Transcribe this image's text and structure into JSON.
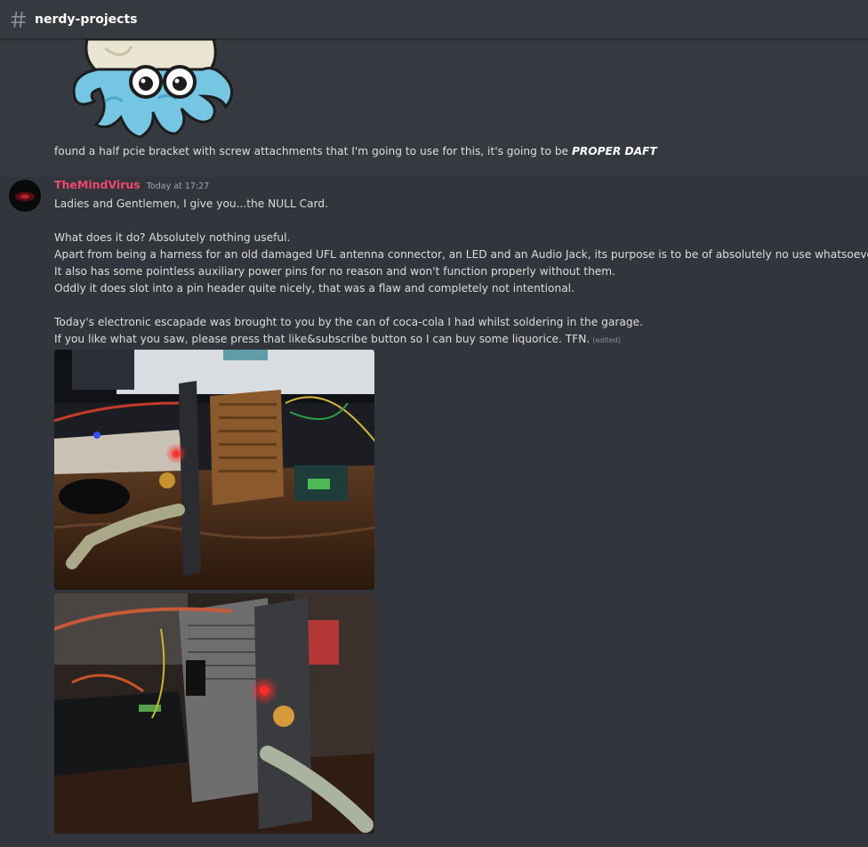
{
  "channel": {
    "name": "nerdy-projects",
    "icon": "hash-icon"
  },
  "messages": {
    "previous": {
      "sticker_icon": "octopus-glasses-sticker",
      "text_prefix": "found a half pcie bracket with screw attachments that I'm going to use for this, it's going to be ",
      "text_emphasis": "PROPER DAFT"
    },
    "current": {
      "author": "TheMindVirus",
      "author_color": "#f04770",
      "timestamp": "Today at 17:27",
      "edited_label": "(edited)",
      "lines": [
        "Ladies and Gentlemen, I give you...the NULL Card.",
        "What does it do? Absolutely nothing useful.",
        "Apart from being a harness for an old damaged UFL antenna connector, an LED and an Audio Jack, its purpose is to be of absolutely no use whatsoever.",
        "It also has some pointless auxiliary power pins for no reason and won't function properly without them.",
        "Oddly it does slot into a pin header quite nicely, that was a flaw and completely not intentional.",
        "Today's electronic escapade was brought to you by the can of coca-cola I had whilst soldering in the garage.",
        "If you like what you saw, please press that like&subscribe button so I can buy some liquorice. TFN."
      ],
      "attachments": [
        {
          "name": "null-card-photo-1"
        },
        {
          "name": "null-card-photo-2"
        }
      ]
    }
  },
  "colors": {
    "background": "#36393f",
    "hover_background": "#32353b",
    "text": "#dcddde",
    "led_red": "#ff2a2a"
  }
}
